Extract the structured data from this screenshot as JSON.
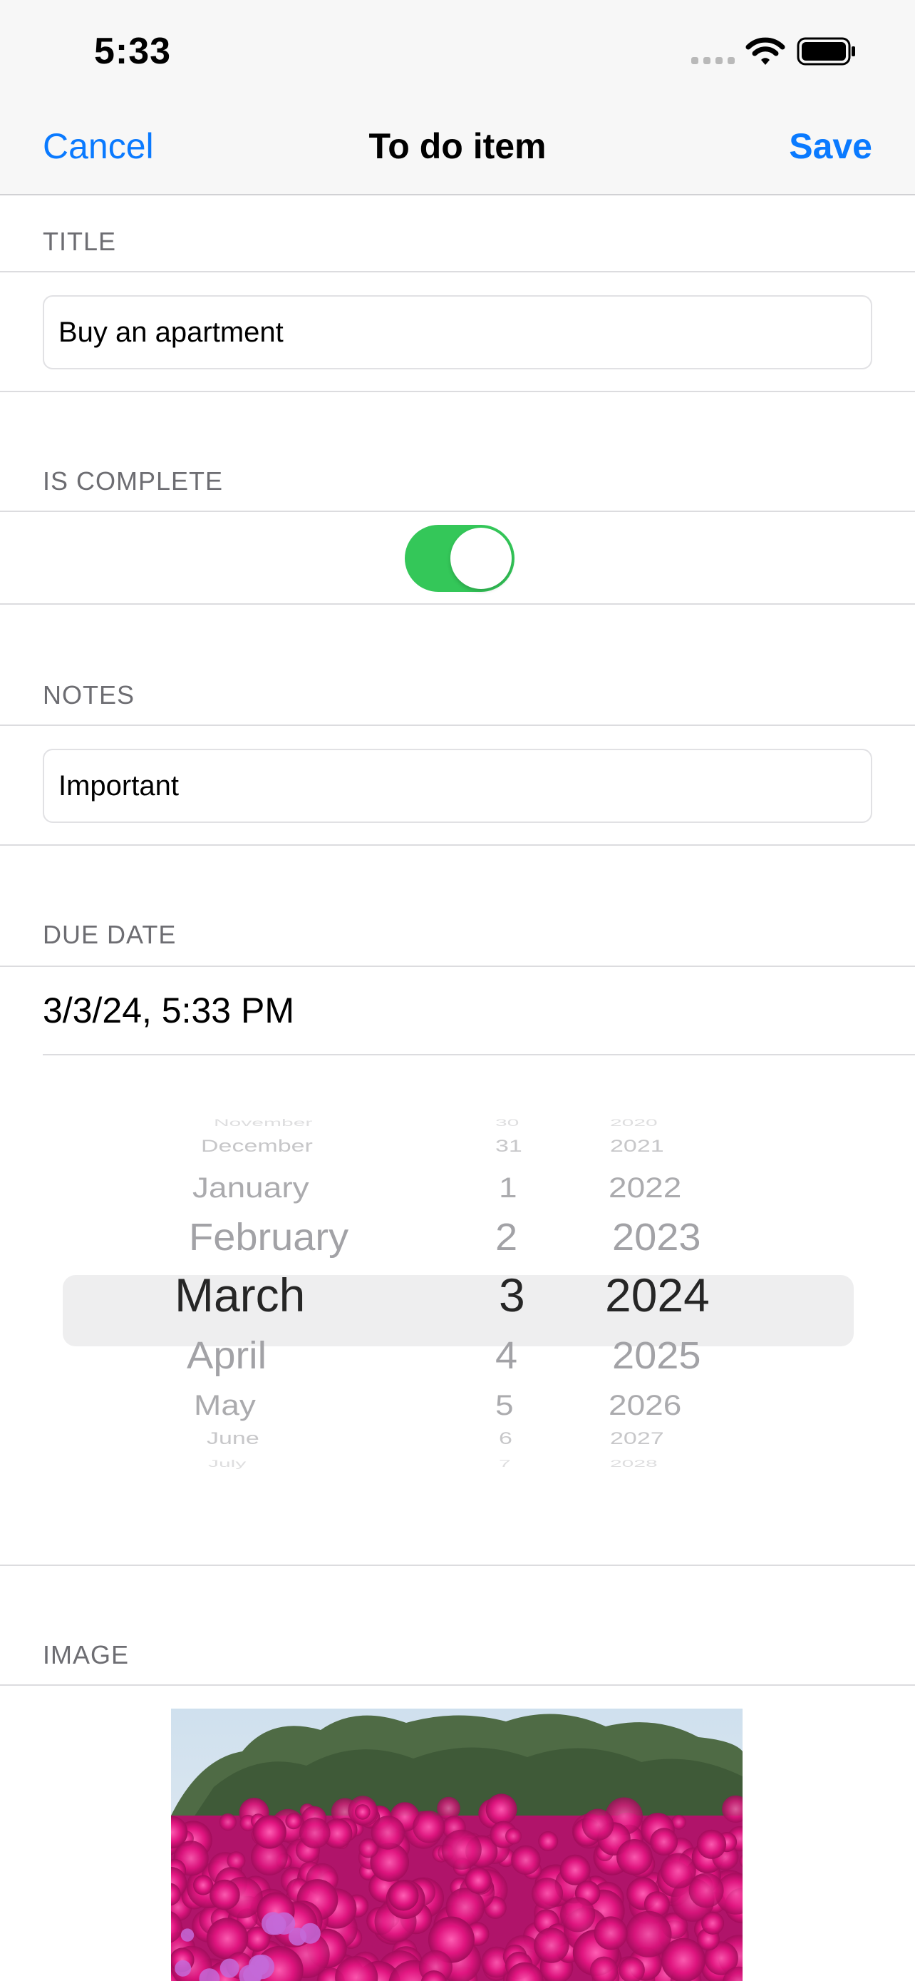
{
  "status_bar": {
    "time": "5:33"
  },
  "nav": {
    "cancel": "Cancel",
    "title": "To do item",
    "save": "Save"
  },
  "sections": {
    "title": {
      "header": "TITLE",
      "value": "Buy an apartment"
    },
    "is_complete": {
      "header": "IS COMPLETE",
      "on": true
    },
    "notes": {
      "header": "NOTES",
      "value": "Important"
    },
    "due_date": {
      "header": "DUE DATE",
      "value": "3/3/24, 5:33 PM"
    },
    "image": {
      "header": "IMAGE"
    }
  },
  "picker": {
    "months": [
      "November",
      "December",
      "January",
      "February",
      "March",
      "April",
      "May",
      "June",
      "July"
    ],
    "days": [
      "30",
      "31",
      "1",
      "2",
      "3",
      "4",
      "5",
      "6",
      "7"
    ],
    "years": [
      "2020",
      "2021",
      "2022",
      "2023",
      "2024",
      "2025",
      "2026",
      "2027",
      "2028"
    ],
    "selected": {
      "month": "March",
      "day": "3",
      "year": "2024"
    }
  },
  "colors": {
    "accent": "#0a7aff",
    "toggle_on": "#34c759"
  },
  "icons": [
    "cellular-signal-icon",
    "wifi-icon",
    "battery-icon"
  ]
}
